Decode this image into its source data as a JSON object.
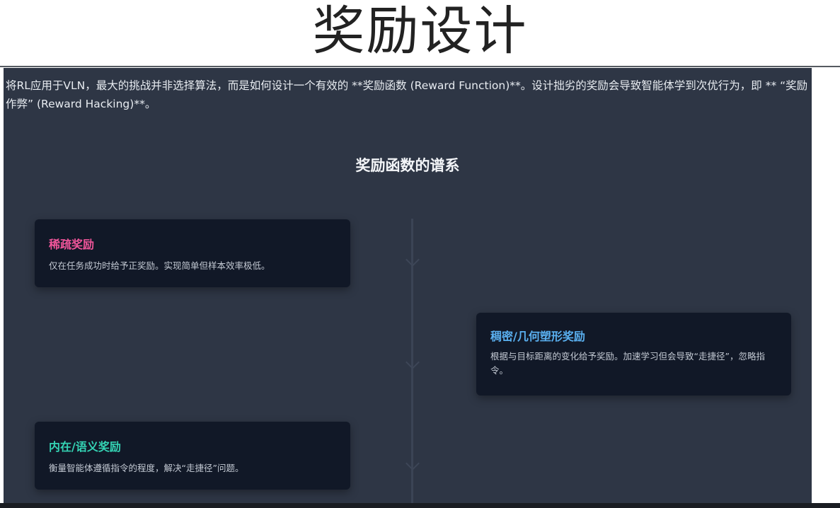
{
  "page": {
    "title": "奖励设计"
  },
  "intro": {
    "text": "将RL应用于VLN，最大的挑战并非选择算法，而是如何设计一个有效的 **奖励函数 (Reward Function)**。设计拙劣的奖励会导致智能体学到次优行为，即 ** “奖励作弊” (Reward Hacking)**。"
  },
  "section": {
    "title": "奖励函数的谱系"
  },
  "timeline": {
    "cards": [
      {
        "title": "稀疏奖励",
        "description": "仅在任务成功时给予正奖励。实现简单但样本效率极低。",
        "color": "#f0559a"
      },
      {
        "title": "稠密/几何塑形奖励",
        "description": "根据与目标距离的变化给予奖励。加速学习但会导致“走捷径”，忽略指令。",
        "color": "#5ab0f0"
      },
      {
        "title": "内在/语义奖励",
        "description": "衡量智能体遵循指令的程度，解决“走捷径”问题。",
        "color": "#34d3b4"
      }
    ]
  },
  "colors": {
    "panel_background": "#2e3645",
    "card_background": "#111827"
  }
}
